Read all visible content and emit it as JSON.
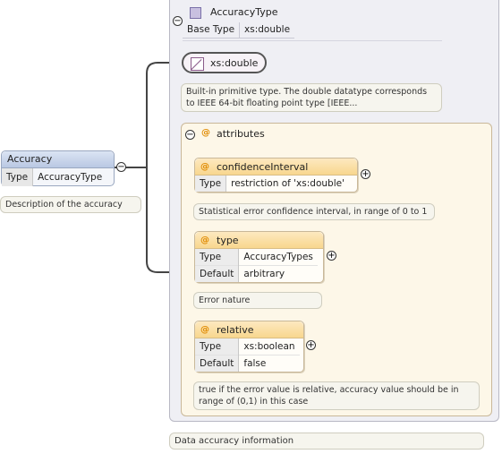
{
  "element": {
    "name": "Accuracy",
    "type_key": "Type",
    "type_value": "AccuracyType",
    "description": "Description of the accuracy"
  },
  "complex_type": {
    "name": "AccuracyType",
    "base_key": "Base Type",
    "base_value": "xs:double",
    "documentation": "Data accuracy information"
  },
  "simple_type": {
    "name": "xs:double",
    "note_line1": "Built-in primitive type. The double datatype corresponds",
    "note_line2": "to IEEE 64-bit floating point type [IEEE..."
  },
  "attributes": {
    "label": "attributes",
    "items": [
      {
        "name": "confidenceInterval",
        "rows": [
          {
            "k": "Type",
            "v": "restriction of 'xs:double'"
          }
        ],
        "note": "Statistical error confidence interval, in range of 0 to 1"
      },
      {
        "name": "type",
        "rows": [
          {
            "k": "Type",
            "v": "AccuracyTypes"
          },
          {
            "k": "Default",
            "v": "arbitrary"
          }
        ],
        "note": "Error nature"
      },
      {
        "name": "relative",
        "rows": [
          {
            "k": "Type",
            "v": "xs:boolean"
          },
          {
            "k": "Default",
            "v": "false"
          }
        ],
        "note_line1": "true if the error value is relative, accuracy value should be in",
        "note_line2": "range of (0,1) in this case"
      }
    ]
  },
  "symbols": {
    "collapse": "−",
    "expand": "+",
    "at": "@"
  },
  "colors": {
    "element_header": "#b9c8e3",
    "attribute_header": "#f8d78e",
    "attribute_panel": "#fdf7e8",
    "complex_panel": "#efeff4"
  }
}
